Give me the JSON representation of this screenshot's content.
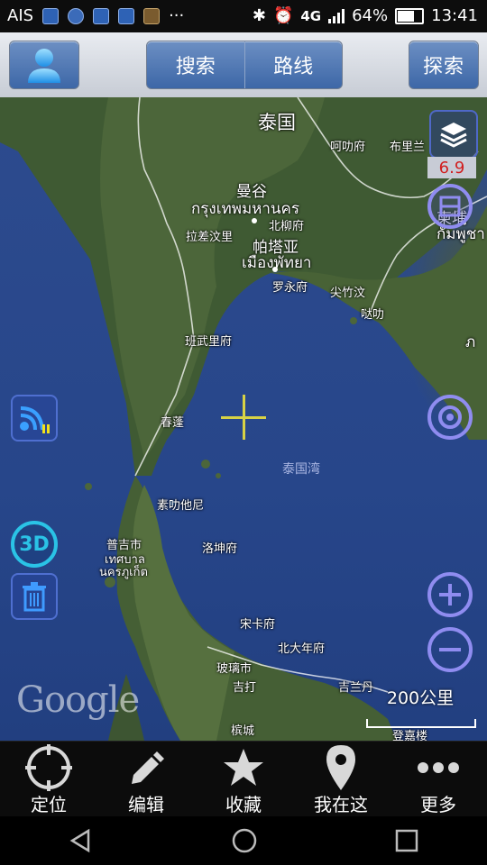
{
  "status_bar": {
    "carrier": "AIS",
    "more": "···",
    "network": "4G",
    "signal_net": "4G",
    "battery_percent": "64%",
    "time": "13:41"
  },
  "top_bar": {
    "search_label": "搜索",
    "route_label": "路线",
    "explore_label": "探索"
  },
  "map": {
    "zoom_level": "6.9",
    "scale_label": "200公里",
    "attribution": "Google",
    "labels": {
      "thailand": "泰国",
      "bangkok_cn": "曼谷",
      "bangkok_th": "กรุงเทพมหานคร",
      "north_liu": "北柳府",
      "ratchaburi": "拉差汶里",
      "pattaya_cn": "帕塔亚",
      "pattaya_th": "เมืองพัทยา",
      "rayong": "罗永府",
      "chanthaburi": "尖竹汶",
      "trat": "哒叻",
      "korat": "呵叻府",
      "buriram": "布里兰",
      "prachuap": "班武里府",
      "chumphon": "春蓬",
      "surat": "素叻他尼",
      "gulf": "泰国湾",
      "phuket_cn": "普吉市",
      "phuket_th1": "เทศบาล",
      "phuket_th2": "นครภูเก็ต",
      "nakhon": "洛坤府",
      "songkhla": "宋卡府",
      "pattani": "北大年府",
      "perlis": "玻璃市",
      "kedah": "吉打",
      "kelantan": "吉兰丹",
      "penang": "槟城",
      "terengganu": "登嘉楼",
      "cambodia_cn": "柬埔",
      "cambodia_th": "กัมพูชา",
      "edge_1": "ภ"
    }
  },
  "bottom_nav": [
    {
      "label": "定位",
      "icon": "locate-icon"
    },
    {
      "label": "编辑",
      "icon": "pencil-icon"
    },
    {
      "label": "收藏",
      "icon": "star-icon"
    },
    {
      "label": "我在这",
      "icon": "pin-icon"
    },
    {
      "label": "更多",
      "icon": "more-dots-icon"
    }
  ]
}
